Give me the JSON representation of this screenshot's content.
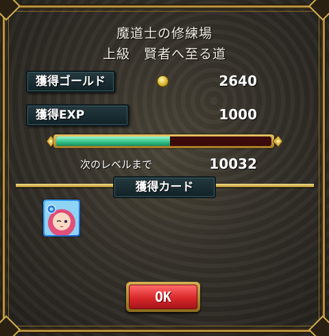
{
  "screen": {
    "dungeon_name": "魔道士の修練場",
    "stage_name": "上級　賢者へ至る道"
  },
  "rewards": {
    "gold_label": "獲得ゴールド",
    "gold_value": "2640",
    "exp_label": "獲得EXP",
    "exp_value": "1000",
    "next_level_label": "次のレベルまで",
    "next_level_value": "10032",
    "exp_progress_fraction": 0.53
  },
  "cards": {
    "section_label": "獲得カード",
    "items": [
      {
        "icon": "mage-girl-card-icon",
        "attribute_color": "#3a8bff"
      }
    ]
  },
  "actions": {
    "ok_label": "OK"
  },
  "colors": {
    "frame_gold": "#c9a24a",
    "label_panel": "#17292d",
    "exp_bar": "#3fd196",
    "ok_button": "#d9282a"
  }
}
